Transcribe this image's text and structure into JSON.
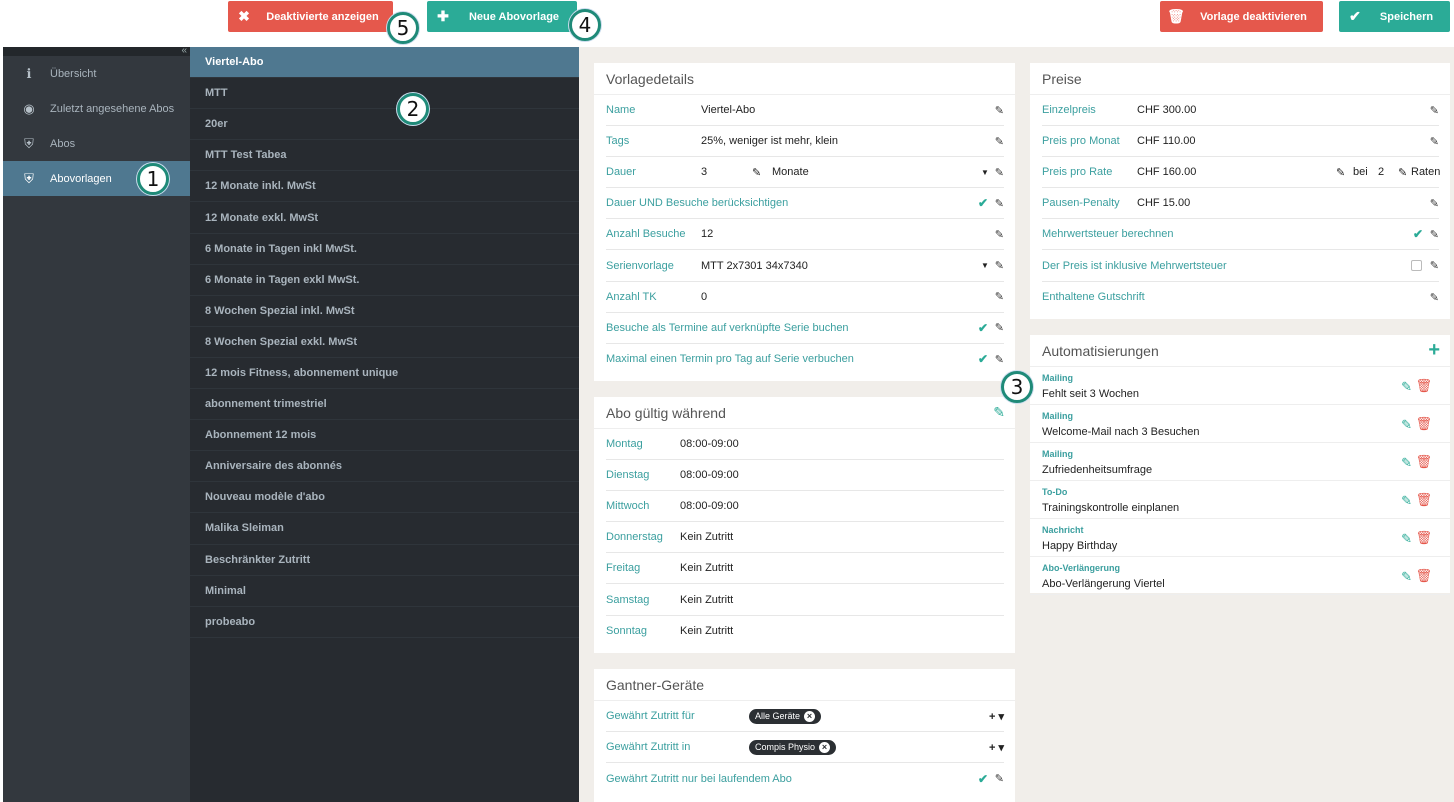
{
  "toolbar": {
    "show_deactivated": "Deaktivierte anzeigen",
    "new_template": "Neue Abovorlage",
    "deactivate_template": "Vorlage deaktivieren",
    "save": "Speichern"
  },
  "callouts": [
    "1",
    "2",
    "3",
    "4",
    "5"
  ],
  "sidebar": {
    "collapse": "«",
    "items": [
      {
        "label": "Übersicht",
        "icon": "info-icon"
      },
      {
        "label": "Zuletzt angesehene Abos",
        "icon": "eye-icon"
      },
      {
        "label": "Abos",
        "icon": "shield-icon"
      },
      {
        "label": "Abovorlagen",
        "icon": "shield-list-icon"
      }
    ]
  },
  "templates": [
    "Viertel-Abo",
    "MTT",
    "20er",
    "MTT Test Tabea",
    "12 Monate inkl. MwSt",
    "12 Monate exkl. MwSt",
    "6 Monate in Tagen inkl MwSt.",
    "6 Monate in Tagen exkl MwSt.",
    "8 Wochen Spezial inkl. MwSt",
    "8 Wochen Spezial exkl. MwSt",
    "12 mois Fitness, abonnement unique",
    "abonnement trimestriel",
    "Abonnement 12 mois",
    "Anniversaire des abonnés",
    "Nouveau modèle d'abo",
    "Malika Sleiman",
    "Beschränkter Zutritt",
    "Minimal",
    "probeabo"
  ],
  "details": {
    "title": "Vorlagedetails",
    "name_label": "Name",
    "name_value": "Viertel-Abo",
    "tags_label": "Tags",
    "tags_value": "25%, weniger ist mehr, klein",
    "duration_label": "Dauer",
    "duration_value": "3",
    "duration_unit": "Monate",
    "duration_visits_label": "Dauer UND Besuche berücksichtigen",
    "visits_label": "Anzahl Besuche",
    "visits_value": "12",
    "series_label": "Serienvorlage",
    "series_value": "MTT 2x7301 34x7340",
    "tk_label": "Anzahl TK",
    "tk_value": "0",
    "book_label": "Besuche als Termine auf verknüpfte Serie buchen",
    "max_label": "Maximal einen Termin pro Tag auf Serie verbuchen"
  },
  "validity": {
    "title": "Abo gültig während",
    "days": [
      {
        "day": "Montag",
        "time": "08:00-09:00"
      },
      {
        "day": "Dienstag",
        "time": "08:00-09:00"
      },
      {
        "day": "Mittwoch",
        "time": "08:00-09:00"
      },
      {
        "day": "Donnerstag",
        "time": "Kein Zutritt"
      },
      {
        "day": "Freitag",
        "time": "Kein Zutritt"
      },
      {
        "day": "Samstag",
        "time": "Kein Zutritt"
      },
      {
        "day": "Sonntag",
        "time": "Kein Zutritt"
      }
    ]
  },
  "gantner": {
    "title": "Gantner-Geräte",
    "access_for_label": "Gewährt Zutritt für",
    "access_for_tag": "Alle Geräte",
    "access_in_label": "Gewährt Zutritt in",
    "access_in_tag": "Compis Physio",
    "running_label": "Gewährt Zutritt nur bei laufendem Abo"
  },
  "prices": {
    "title": "Preise",
    "single_label": "Einzelpreis",
    "single_value": "CHF 300.00",
    "month_label": "Preis pro Monat",
    "month_value": "CHF 110.00",
    "rate_label": "Preis pro Rate",
    "rate_value": "CHF 160.00",
    "rate_bei": "bei",
    "rate_count": "2",
    "rate_unit": "Raten",
    "pause_label": "Pausen-Penalty",
    "pause_value": "CHF 15.00",
    "vat_label": "Mehrwertsteuer berechnen",
    "incl_label": "Der Preis ist inklusive Mehrwertsteuer",
    "voucher_label": "Enthaltene Gutschrift"
  },
  "automations": {
    "title": "Automatisierungen",
    "items": [
      {
        "type": "Mailing",
        "desc": "Fehlt seit 3 Wochen"
      },
      {
        "type": "Mailing",
        "desc": "Welcome-Mail nach 3 Besuchen"
      },
      {
        "type": "Mailing",
        "desc": "Zufriedenheitsumfrage"
      },
      {
        "type": "To-Do",
        "desc": "Trainingskontrolle einplanen"
      },
      {
        "type": "Nachricht",
        "desc": "Happy Birthday"
      },
      {
        "type": "Abo-Verlängerung",
        "desc": "Abo-Verlängerung Viertel"
      }
    ]
  },
  "colors": {
    "accent": "#2bab97",
    "danger": "#e5584c",
    "sidebar": "#33383e",
    "active": "#4f7890"
  }
}
